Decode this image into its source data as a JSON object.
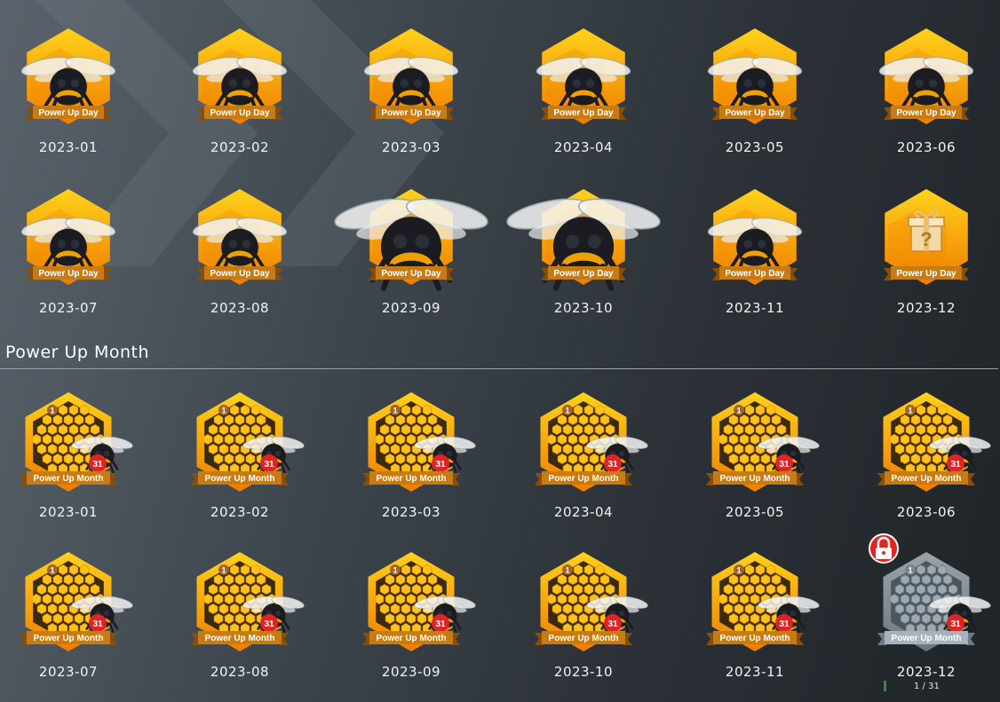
{
  "colors": {
    "gold_light": "#ffd21a",
    "gold_dark": "#f07c00",
    "ribbon": "#c77b12",
    "ribbon_dark": "#8a4f07",
    "locked_grey": "#8c969e",
    "lock_red": "#e02424",
    "count_red": "#e02424"
  },
  "day_section": {
    "badge_label": "Power Up Day",
    "badges": [
      {
        "date": "2023-01",
        "icon": "bee-icon",
        "variant": "small"
      },
      {
        "date": "2023-02",
        "icon": "bee-icon",
        "variant": "small"
      },
      {
        "date": "2023-03",
        "icon": "bee-icon",
        "variant": "small"
      },
      {
        "date": "2023-04",
        "icon": "bee-icon",
        "variant": "small"
      },
      {
        "date": "2023-05",
        "icon": "bee-icon",
        "variant": "small"
      },
      {
        "date": "2023-06",
        "icon": "bee-icon",
        "variant": "small"
      },
      {
        "date": "2023-07",
        "icon": "bee-icon",
        "variant": "small"
      },
      {
        "date": "2023-08",
        "icon": "bee-icon",
        "variant": "small"
      },
      {
        "date": "2023-09",
        "icon": "bee-icon",
        "variant": "large"
      },
      {
        "date": "2023-10",
        "icon": "bee-icon",
        "variant": "large"
      },
      {
        "date": "2023-11",
        "icon": "bee-icon",
        "variant": "small"
      },
      {
        "date": "2023-12",
        "icon": "gift-icon",
        "variant": "gift"
      }
    ]
  },
  "month_section": {
    "title": "Power Up Month",
    "badge_label": "Power Up Month",
    "start_number": "1",
    "count_number": "31",
    "badges": [
      {
        "date": "2023-01",
        "locked": false
      },
      {
        "date": "2023-02",
        "locked": false
      },
      {
        "date": "2023-03",
        "locked": false
      },
      {
        "date": "2023-04",
        "locked": false
      },
      {
        "date": "2023-05",
        "locked": false
      },
      {
        "date": "2023-06",
        "locked": false
      },
      {
        "date": "2023-07",
        "locked": false
      },
      {
        "date": "2023-08",
        "locked": false
      },
      {
        "date": "2023-09",
        "locked": false
      },
      {
        "date": "2023-10",
        "locked": false
      },
      {
        "date": "2023-11",
        "locked": false
      },
      {
        "date": "2023-12",
        "locked": true,
        "progress_text": "1 / 31",
        "progress_fraction": 0.0323
      }
    ]
  }
}
